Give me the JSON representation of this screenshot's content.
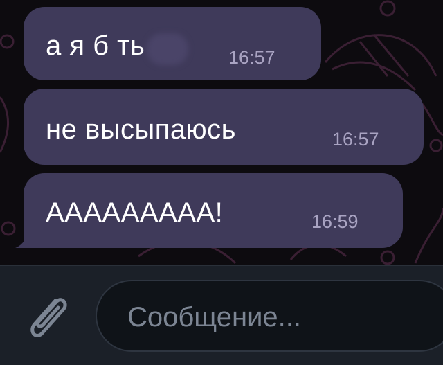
{
  "messages": [
    {
      "text": "а я б   ть",
      "time": "16:57"
    },
    {
      "text": "не высыпаюсь",
      "time": "16:57"
    },
    {
      "text": "АААААААААǃ",
      "time": "16:59"
    }
  ],
  "composer": {
    "placeholder": "Сообщение..."
  },
  "colors": {
    "bubble": "#3f3a5a",
    "time": "#a9a3c2",
    "composer_bg": "#1b2028",
    "input_bg": "#0f1318",
    "placeholder": "#7c8593"
  },
  "icons": {
    "attach": "paperclip-icon"
  }
}
